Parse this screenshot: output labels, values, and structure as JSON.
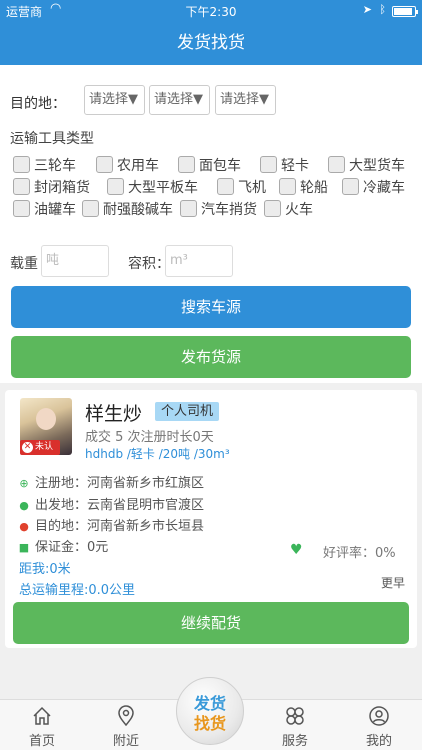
{
  "status_bar": {
    "carrier": "运营商",
    "time": "下午2:30"
  },
  "header": {
    "title": "发货找货"
  },
  "filters": {
    "destination_label": "目的地：",
    "selects": [
      "请选择▼",
      "请选择▼",
      "请选择▼"
    ],
    "transport_title": "运输工具类型",
    "vehicle_types": [
      "三轮车",
      "农用车",
      "面包车",
      "轻卡",
      "大型货车",
      "封闭箱货",
      "大型平板车",
      "飞机",
      "轮船",
      "冷藏车",
      "油罐车",
      "耐强酸碱车",
      "汽车捎货",
      "火车"
    ],
    "weight_label": "载重",
    "weight_placeholder": "吨",
    "volume_label": "容积：",
    "volume_placeholder": "m³"
  },
  "buttons": {
    "search": "搜索车源",
    "publish": "发布货源",
    "continue": "继续配货"
  },
  "driver": {
    "name": "样生炒",
    "type": "个人司机",
    "unverified": "未认证",
    "deal_info": "成交 5 次注册时长0天",
    "vehicle_info": "hdhdb /轻卡 /20吨 /30m³",
    "register_place": "注册地：河南省新乡市红旗区",
    "departure": "出发地：云南省昆明市官渡区",
    "destination": "目的地：河南省新乡市长垣县",
    "deposit": "保证金：0元",
    "rating": "好评率：0%",
    "distance": "距我:0米",
    "mileage": "总运输里程:0.0公里",
    "more": "更早"
  },
  "tabs": [
    "首页",
    "附近",
    "服务",
    "我的"
  ],
  "center_button": {
    "line1": "发货",
    "line2": "找货"
  }
}
